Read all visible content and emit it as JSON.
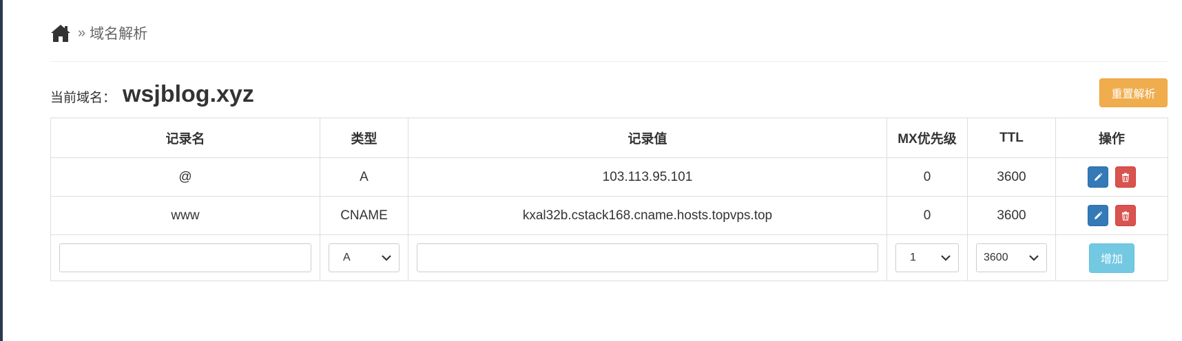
{
  "breadcrumb": {
    "separator": "»",
    "current": "域名解析"
  },
  "domain": {
    "label": "当前域名：",
    "value": "wsjblog.xyz"
  },
  "actions": {
    "reset_label": "重置解析",
    "add_label": "增加"
  },
  "table": {
    "headers": [
      "记录名",
      "类型",
      "记录值",
      "MX优先级",
      "TTL",
      "操作"
    ],
    "rows": [
      {
        "name": "@",
        "type": "A",
        "value": "103.113.95.101",
        "mx": "0",
        "ttl": "3600"
      },
      {
        "name": "www",
        "type": "CNAME",
        "value": "kxal32b.cstack168.cname.hosts.topvps.top",
        "mx": "0",
        "ttl": "3600"
      }
    ]
  },
  "new_record": {
    "name_value": "",
    "type_selected": "A",
    "value_value": "",
    "mx_selected": "1",
    "ttl_selected": "3600"
  },
  "colors": {
    "reset_button": "#f0ad4e",
    "edit_button": "#337ab7",
    "delete_button": "#d9534f",
    "add_button": "#5bc0de"
  },
  "icons": {
    "home": "home-icon",
    "edit": "pencil-icon",
    "delete": "trash-icon",
    "dropdown": "chevron-down-icon"
  }
}
